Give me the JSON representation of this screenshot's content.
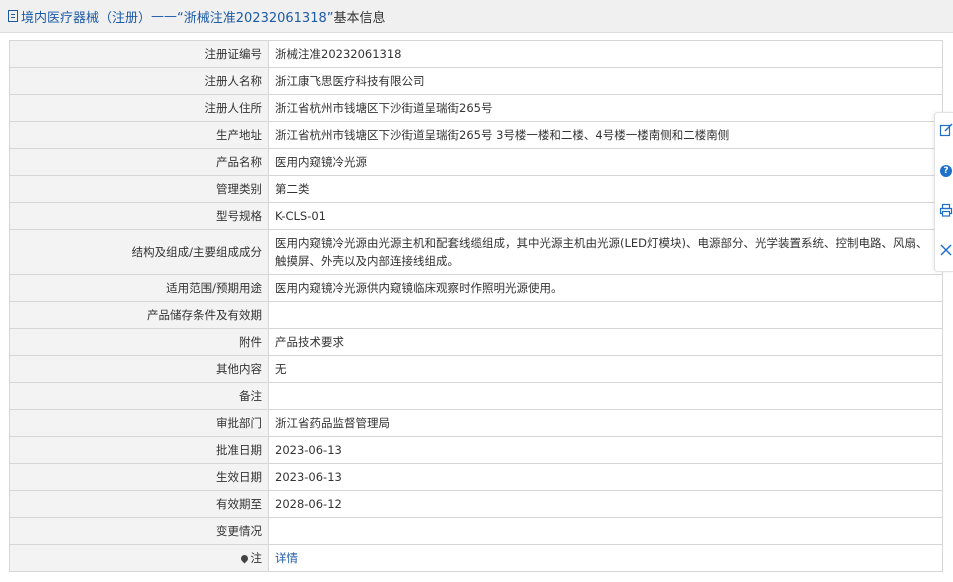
{
  "header": {
    "prefix": "境内医疗器械（注册）",
    "separator": " —— ",
    "quoted_number": "“浙械注准20232061318”",
    "suffix": " 基本信息"
  },
  "rows": [
    {
      "label": "注册证编号",
      "value": "浙械注准20232061318"
    },
    {
      "label": "注册人名称",
      "value": "浙江康飞思医疗科技有限公司"
    },
    {
      "label": "注册人住所",
      "value": "浙江省杭州市钱塘区下沙街道呈瑞街265号"
    },
    {
      "label": "生产地址",
      "value": "浙江省杭州市钱塘区下沙街道呈瑞街265号 3号楼一楼和二楼、4号楼一楼南侧和二楼南侧"
    },
    {
      "label": "产品名称",
      "value": "医用内窥镜冷光源"
    },
    {
      "label": "管理类别",
      "value": "第二类"
    },
    {
      "label": "型号规格",
      "value": "K-CLS-01"
    },
    {
      "label": "结构及组成/主要组成成分",
      "value": "医用内窥镜冷光源由光源主机和配套线缆组成，其中光源主机由光源(LED灯模块)、电源部分、光学装置系统、控制电路、风扇、触摸屏、外壳以及内部连接线组成。"
    },
    {
      "label": "适用范围/预期用途",
      "value": "医用内窥镜冷光源供内窥镜临床观察时作照明光源使用。"
    },
    {
      "label": "产品储存条件及有效期",
      "value": ""
    },
    {
      "label": "附件",
      "value": "产品技术要求"
    },
    {
      "label": "其他内容",
      "value": "无"
    },
    {
      "label": "备注",
      "value": ""
    },
    {
      "label": "审批部门",
      "value": "浙江省药品监督管理局"
    },
    {
      "label": "批准日期",
      "value": "2023-06-13"
    },
    {
      "label": "生效日期",
      "value": "2023-06-13"
    },
    {
      "label": "有效期至",
      "value": "2028-06-12"
    },
    {
      "label": "变更情况",
      "value": ""
    },
    {
      "label": "注",
      "value": "详情"
    }
  ],
  "side_tools": [
    {
      "icon": "edit-icon"
    },
    {
      "icon": "help-icon",
      "glyph": "?"
    },
    {
      "icon": "print-icon"
    },
    {
      "icon": "close-icon"
    }
  ],
  "colors": {
    "link": "#1d5aa8",
    "label_bg": "#f3f3f3",
    "border": "#d6d6d6",
    "header_bg": "#f0f0f0"
  }
}
